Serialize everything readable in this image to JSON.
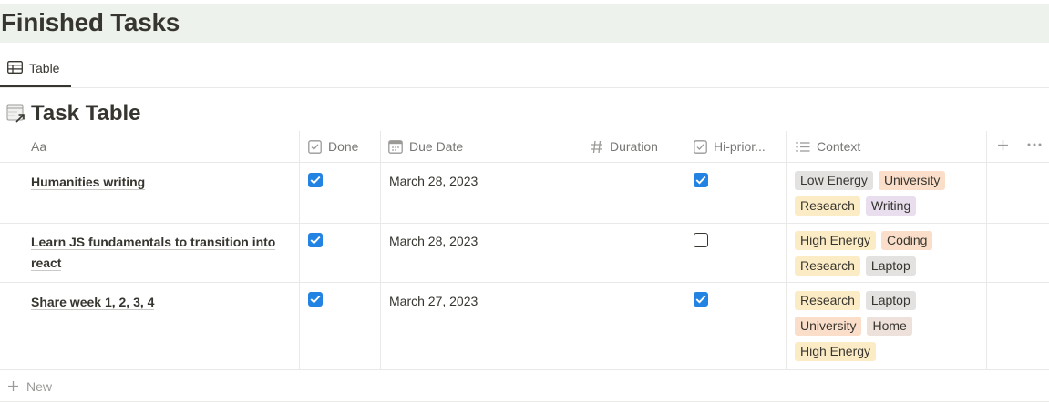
{
  "page": {
    "title": "Finished Tasks"
  },
  "view_tabs": [
    {
      "label": "Table",
      "icon": "table-icon"
    }
  ],
  "database": {
    "title": "Task Table",
    "icon": "linked-database-icon"
  },
  "columns": {
    "name": {
      "label": "Aa",
      "icon": ""
    },
    "done": {
      "label": "Done",
      "icon": "checkbox-icon"
    },
    "due": {
      "label": "Due Date",
      "icon": "calendar-icon"
    },
    "duration": {
      "label": "Duration",
      "icon": "hash-icon"
    },
    "hipri": {
      "label": "Hi-prior...",
      "icon": "checkbox-icon"
    },
    "context": {
      "label": "Context",
      "icon": "list-icon"
    }
  },
  "rows": [
    {
      "name": "Humanities writing",
      "done": true,
      "due": "March 28, 2023",
      "duration": "",
      "hipri": true,
      "context": [
        "Low Energy",
        "University",
        "Research",
        "Writing"
      ]
    },
    {
      "name": "Learn JS fundamentals to transition into react",
      "done": true,
      "due": "March 28, 2023",
      "duration": "",
      "hipri": false,
      "context": [
        "High Energy",
        "Coding",
        "Research",
        "Laptop"
      ]
    },
    {
      "name": "Share week 1, 2, 3, 4",
      "done": true,
      "due": "March 27, 2023",
      "duration": "",
      "hipri": true,
      "context": [
        "Research",
        "Laptop",
        "University",
        "Home",
        "High Energy"
      ]
    }
  ],
  "new_row": {
    "label": "New"
  },
  "colors": {
    "banner": "#edf3ec",
    "checkbox_on": "#2383e2",
    "tag_gray": "#e3e2e0",
    "tag_orange": "#fadec9",
    "tag_yellow": "#fbecc6",
    "tag_purple": "#e8deee",
    "tag_brown": "#eee0da"
  }
}
